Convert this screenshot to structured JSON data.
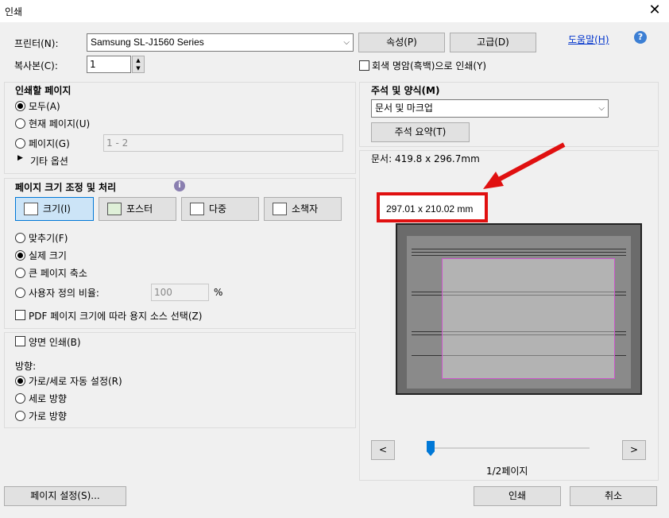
{
  "window": {
    "title": "인쇄",
    "close_symbol": "✕"
  },
  "top": {
    "printer_label": "프린터(N):",
    "printer_value": "Samsung SL-J1560 Series",
    "properties_button": "속성(P)",
    "advanced_button": "고급(D)",
    "help_link": "도움말(H)",
    "copies_label": "복사본(C):",
    "copies_value": "1",
    "grayscale_label": "회색 명암(흑백)으로 인쇄(Y)"
  },
  "pages_to_print": {
    "heading": "인쇄할 페이지",
    "options": [
      "모두(A)",
      "현재 페이지(U)",
      "페이지(G)"
    ],
    "selected": 0,
    "pages_input_value": "1 - 2",
    "more_options": "기타 옵션"
  },
  "page_sizing": {
    "heading": "페이지 크기 조정 및 처리",
    "tools": [
      "크기(I)",
      "포스터",
      "다중",
      "소책자"
    ],
    "active_tool": 0,
    "options": [
      "맞추기(F)",
      "실제 크기",
      "큰 페이지 축소",
      "사용자 정의 비율:"
    ],
    "selected": 1,
    "custom_scale_value": "100",
    "percent": "%",
    "pdf_paper_source": "PDF 페이지 크기에 따라 용지 소스 선택(Z)"
  },
  "duplex": {
    "label": "양면 인쇄(B)"
  },
  "orientation": {
    "heading": "방향:",
    "options": [
      "가로/세로 자동 설정(R)",
      "세로 방향",
      "가로 방향"
    ],
    "selected": 0
  },
  "comments_forms": {
    "heading": "주석 및 양식(M)",
    "select_value": "문서 및 마크업",
    "summarize_button": "주석 요약(T)"
  },
  "preview": {
    "doc_size": "문서: 419.8 x 296.7mm",
    "callout_size": "297.01 x 210.02 mm",
    "prev_button": "<",
    "next_button": ">",
    "page_indicator": "1/2페이지",
    "slider_position": 0
  },
  "bottom": {
    "page_setup_button": "페이지 설정(S)...",
    "print_button": "인쇄",
    "cancel_button": "취소"
  },
  "colors": {
    "accent": "#0078d7",
    "callout_red": "#e01010",
    "help_icon": "#3c7fd4"
  }
}
